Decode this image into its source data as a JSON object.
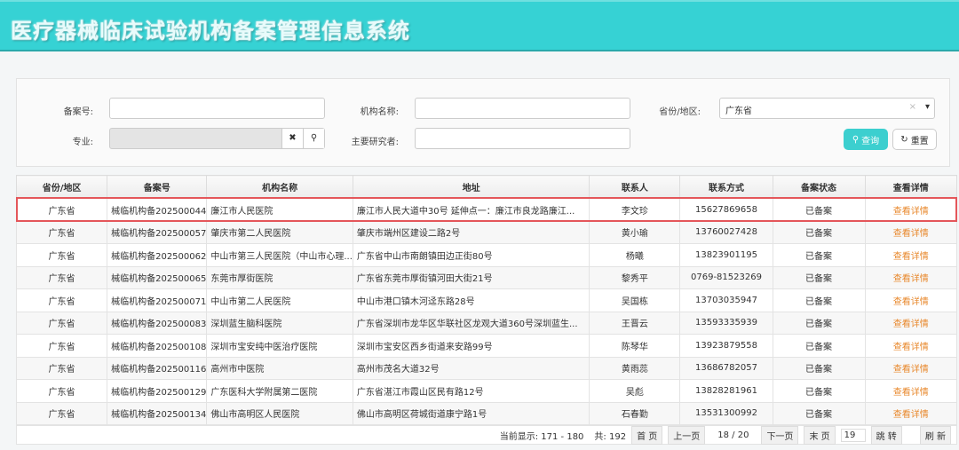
{
  "app": {
    "title": "医疗器械临床试验机构备案管理信息系统"
  },
  "search": {
    "record_no_label": "备案号:",
    "record_no_value": "",
    "org_name_label": "机构名称:",
    "org_name_value": "",
    "province_label": "省份/地区:",
    "province_value": "广东省",
    "clear_symbol": "×",
    "dropdown_symbol": "▾",
    "specialty_label": "专业:",
    "specialty_value": "",
    "clear_button": "✖",
    "pi_label": "主要研究者:",
    "pi_value": "",
    "query_button": "查询",
    "reset_button": "重置"
  },
  "table": {
    "headers": [
      "省份/地区",
      "备案号",
      "机构名称",
      "地址",
      "联系人",
      "联系方式",
      "备案状态",
      "查看详情"
    ],
    "rows": [
      [
        "广东省",
        "械临机构备202500044",
        "廉江市人民医院",
        "廉江市人民大道中30号 延伸点一：廉江市良龙路廉江...",
        "李文珍",
        "15627869658",
        "已备案",
        "查看详情"
      ],
      [
        "广东省",
        "械临机构备202500057",
        "肇庆市第二人民医院",
        "肇庆市端州区建设二路2号",
        "黄小瑜",
        "13760027428",
        "已备案",
        "查看详情"
      ],
      [
        "广东省",
        "械临机构备202500062",
        "中山市第三人民医院（中山市心理...",
        "广东省中山市南朗镇田边正街80号",
        "杨曦",
        "13823901195",
        "已备案",
        "查看详情"
      ],
      [
        "广东省",
        "械临机构备202500065",
        "东莞市厚街医院",
        "广东省东莞市厚街镇河田大街21号",
        "黎秀平",
        "0769-81523269",
        "已备案",
        "查看详情"
      ],
      [
        "广东省",
        "械临机构备202500071",
        "中山市第二人民医院",
        "中山市港口镇木河迳东路28号",
        "吴国栋",
        "13703035947",
        "已备案",
        "查看详情"
      ],
      [
        "广东省",
        "械临机构备202500083",
        "深圳蓝生脑科医院",
        "广东省深圳市龙华区华联社区龙观大道360号深圳蓝生...",
        "王晋云",
        "13593335939",
        "已备案",
        "查看详情"
      ],
      [
        "广东省",
        "械临机构备202500108",
        "深圳市宝安纯中医治疗医院",
        "深圳市宝安区西乡街道来安路99号",
        "陈琴华",
        "13923879558",
        "已备案",
        "查看详情"
      ],
      [
        "广东省",
        "械临机构备202500116",
        "高州市中医院",
        "高州市茂名大道32号",
        "黄雨蕊",
        "13686782057",
        "已备案",
        "查看详情"
      ],
      [
        "广东省",
        "械临机构备202500129",
        "广东医科大学附属第二医院",
        "广东省湛江市霞山区民有路12号",
        "吴彪",
        "13828281961",
        "已备案",
        "查看详情"
      ],
      [
        "广东省",
        "械临机构备202500134",
        "佛山市高明区人民医院",
        "佛山市高明区荷城街道康宁路1号",
        "石春勤",
        "13531300992",
        "已备案",
        "查看详情"
      ]
    ]
  },
  "pager": {
    "showing": "当前显示: 171 - 180",
    "total": "共: 192",
    "first": "首 页",
    "prev": "上一页",
    "page": "18 / 20",
    "next": "下一页",
    "last": "末 页",
    "jump_value": "19",
    "jump": "跳 转",
    "refresh": "刷 新"
  }
}
